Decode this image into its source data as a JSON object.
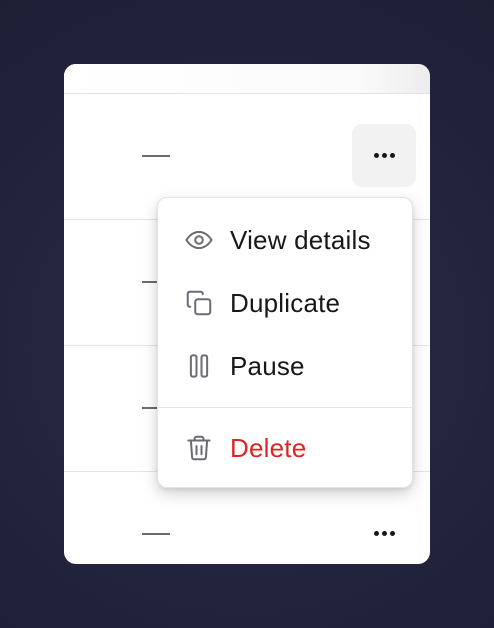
{
  "table": {
    "rows": [
      {
        "placeholder": "—",
        "menu_icon": "ellipsis-horizontal-icon"
      },
      {
        "placeholder": "—",
        "menu_icon": "ellipsis-horizontal-icon"
      },
      {
        "placeholder": "—",
        "menu_icon": "ellipsis-horizontal-icon"
      },
      {
        "placeholder": "—",
        "menu_icon": "ellipsis-horizontal-icon"
      }
    ]
  },
  "menu": {
    "items": [
      {
        "label": "View details",
        "icon": "eye-icon"
      },
      {
        "label": "Duplicate",
        "icon": "copy-icon"
      },
      {
        "label": "Pause",
        "icon": "pause-icon"
      },
      {
        "label": "Delete",
        "icon": "trash-icon",
        "color": "#dc2626"
      }
    ]
  },
  "colors": {
    "background": "#20223a",
    "card": "#ffffff",
    "danger": "#dc2626",
    "text": "#18181b",
    "icon": "#6b6b73"
  }
}
